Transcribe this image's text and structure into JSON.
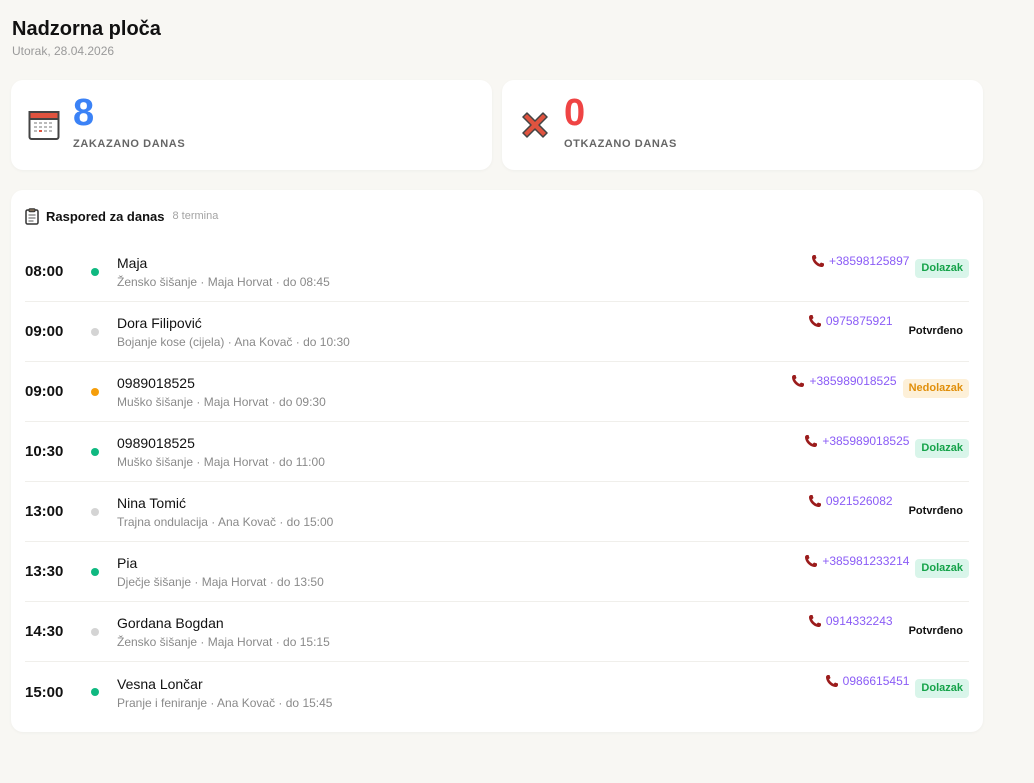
{
  "header": {
    "title": "Nadzorna ploča",
    "date": "Utorak, 28.04.2026"
  },
  "stats": {
    "booked": {
      "value": "8",
      "label": "ZAKAZANO DANAS",
      "icon": "calendar-icon",
      "color": "#3b82f6"
    },
    "cancelled": {
      "value": "0",
      "label": "OTKAZANO DANAS",
      "icon": "cross-icon",
      "color": "#ef4444"
    }
  },
  "schedule": {
    "title": "Raspored za danas",
    "count": "8 termina",
    "icon": "clipboard-icon",
    "rows": [
      {
        "time": "08:00",
        "status": "green",
        "client": "Maja",
        "details": "Žensko šišanje · Maja Horvat · do 08:45",
        "phone": "+38598125897",
        "badge": "Dolazak",
        "badge_type": "arrive"
      },
      {
        "time": "09:00",
        "status": "gray",
        "client": "Dora Filipović",
        "details": "Bojanje kose (cijela) · Ana Kovač · do 10:30",
        "phone": "0975875921",
        "badge": "Potvrđeno",
        "badge_type": "confirmed"
      },
      {
        "time": "09:00",
        "status": "orange",
        "client": "0989018525",
        "details": "Muško šišanje · Maja Horvat · do 09:30",
        "phone": "+385989018525",
        "badge": "Nedolazak",
        "badge_type": "noshow"
      },
      {
        "time": "10:30",
        "status": "green",
        "client": "0989018525",
        "details": "Muško šišanje · Maja Horvat · do 11:00",
        "phone": "+385989018525",
        "badge": "Dolazak",
        "badge_type": "arrive"
      },
      {
        "time": "13:00",
        "status": "gray",
        "client": "Nina Tomić",
        "details": "Trajna ondulacija · Ana Kovač · do 15:00",
        "phone": "0921526082",
        "badge": "Potvrđeno",
        "badge_type": "confirmed"
      },
      {
        "time": "13:30",
        "status": "green",
        "client": "Pia",
        "details": "Dječje šišanje · Maja Horvat · do 13:50",
        "phone": "+385981233214",
        "badge": "Dolazak",
        "badge_type": "arrive"
      },
      {
        "time": "14:30",
        "status": "gray",
        "client": "Gordana Bogdan",
        "details": "Žensko šišanje · Maja Horvat · do 15:15",
        "phone": "0914332243",
        "badge": "Potvrđeno",
        "badge_type": "confirmed"
      },
      {
        "time": "15:00",
        "status": "green",
        "client": "Vesna Lončar",
        "details": "Pranje i feniranje · Ana Kovač · do 15:45",
        "phone": "0986615451",
        "badge": "Dolazak",
        "badge_type": "arrive"
      }
    ]
  },
  "colors": {
    "background": "#f8f7f3",
    "phone": "#8b5cf6",
    "status_green": "#10b981",
    "status_gray": "#d4d4d4",
    "status_orange": "#f59e0b"
  }
}
